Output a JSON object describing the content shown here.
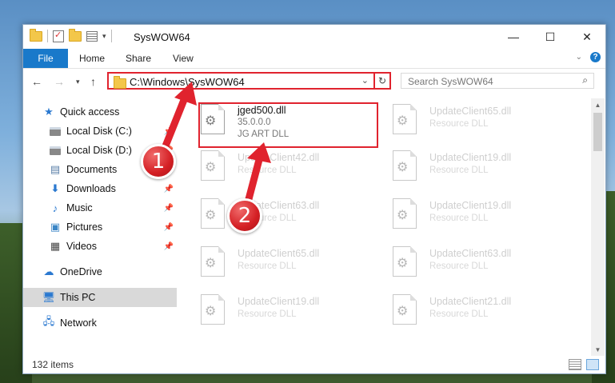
{
  "window": {
    "title": "SysWOW64"
  },
  "ribbon": {
    "tabs": [
      "File",
      "Home",
      "Share",
      "View"
    ]
  },
  "nav": {
    "address": "C:\\Windows\\SysWOW64",
    "search_placeholder": "Search SysWOW64"
  },
  "sidebar": {
    "items": [
      {
        "label": "Quick access",
        "icon": "star-icon"
      },
      {
        "label": "Local Disk (C:)",
        "icon": "drive-icon"
      },
      {
        "label": "Local Disk (D:)",
        "icon": "drive-icon"
      },
      {
        "label": "Documents",
        "icon": "document-icon"
      },
      {
        "label": "Downloads",
        "icon": "download-icon"
      },
      {
        "label": "Music",
        "icon": "music-icon"
      },
      {
        "label": "Pictures",
        "icon": "pictures-icon"
      },
      {
        "label": "Videos",
        "icon": "video-icon"
      },
      {
        "label": "OneDrive",
        "icon": "cloud-icon"
      },
      {
        "label": "This PC",
        "icon": "pc-icon"
      },
      {
        "label": "Network",
        "icon": "network-icon"
      }
    ]
  },
  "files": {
    "active": {
      "name": "jged500.dll",
      "version": "35.0.0.0",
      "type": "JG ART DLL"
    },
    "items": [
      {
        "name": "UpdateClient65.dll",
        "type": "Resource DLL"
      },
      {
        "name": "UpdateClient42.dll",
        "type": "Resource DLL"
      },
      {
        "name": "UpdateClient19.dll",
        "type": "Resource DLL"
      },
      {
        "name": "UpdateClient63.dll",
        "type": "Resource DLL"
      },
      {
        "name": "UpdateClient19.dll",
        "type": "Resource DLL"
      },
      {
        "name": "UpdateClient65.dll",
        "type": "Resource DLL"
      },
      {
        "name": "UpdateClient63.dll",
        "type": "Resource DLL"
      },
      {
        "name": "UpdateClient19.dll",
        "type": "Resource DLL"
      },
      {
        "name": "UpdateClient21.dll",
        "type": "Resource DLL"
      }
    ]
  },
  "status": {
    "count": "132 items"
  },
  "annotations": {
    "badge1": "1",
    "badge2": "2",
    "color": "#e0232e"
  }
}
